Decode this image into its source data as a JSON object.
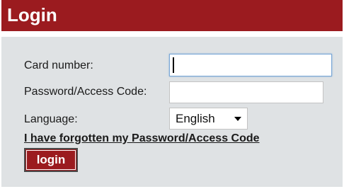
{
  "header": {
    "title": "Login"
  },
  "form": {
    "card_number_label": "Card number:",
    "card_number_value": "",
    "password_label": "Password/Access Code:",
    "password_value": "",
    "language_label": "Language:",
    "language_selected": "English",
    "forgot_link": "I have forgotten my Password/Access Code",
    "login_button": "login"
  },
  "colors": {
    "brand": "#9b1b1f",
    "panel_background": "#dfe2e4",
    "focus_border": "#7aa7d6"
  },
  "icons": {
    "select_arrow": "chevron-down-icon"
  }
}
